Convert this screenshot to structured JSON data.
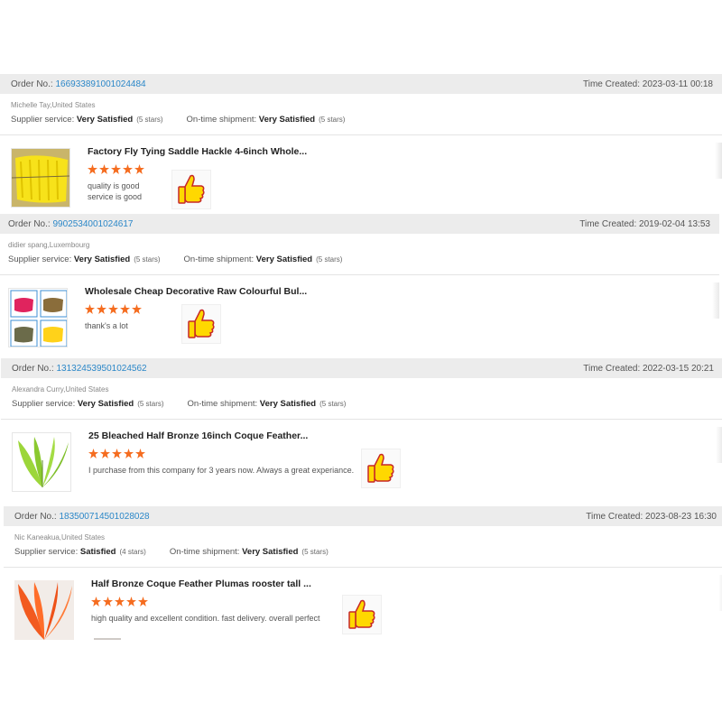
{
  "reviews": [
    {
      "order_label": "Order No.:",
      "order_no": "166933891001024484",
      "time_label": "Time Created:",
      "time_created": "2023-03-11 00:18",
      "buyer": "Michelle Tay,United States",
      "supplier_label": "Supplier service:",
      "supplier_value": "Very Satisfied",
      "supplier_stars": "(5 stars)",
      "shipment_label": "On-time shipment:",
      "shipment_value": "Very Satisfied",
      "shipment_stars": "(5 stars)",
      "product_title": "Factory Fly Tying Saddle Hackle 4-6inch Whole...",
      "rating": 5,
      "comment_lines": [
        "quality is good",
        "service is good"
      ]
    },
    {
      "order_label": "Order No.:",
      "order_no": "9902534001024617",
      "time_label": "Time Created:",
      "time_created": "2019-02-04 13:53",
      "buyer": "didier spang,Luxembourg",
      "supplier_label": "Supplier service:",
      "supplier_value": "Very Satisfied",
      "supplier_stars": "(5 stars)",
      "shipment_label": "On-time shipment:",
      "shipment_value": "Very Satisfied",
      "shipment_stars": "(5 stars)",
      "product_title": "Wholesale Cheap Decorative Raw Colourful Bul...",
      "rating": 5,
      "comment_lines": [
        "thank's a lot"
      ]
    },
    {
      "order_label": "Order No.:",
      "order_no": "131324539501024562",
      "time_label": "Time Created:",
      "time_created": "2022-03-15 20:21",
      "buyer": "Alexandra Curry,United States",
      "supplier_label": "Supplier service:",
      "supplier_value": "Very Satisfied",
      "supplier_stars": "(5 stars)",
      "shipment_label": "On-time shipment:",
      "shipment_value": "Very Satisfied",
      "shipment_stars": "(5 stars)",
      "product_title": "25 Bleached Half Bronze 16inch Coque Feather...",
      "rating": 5,
      "comment_lines": [
        "I purchase from this company for 3 years now. Always a great experiance."
      ]
    },
    {
      "order_label": "Order No.:",
      "order_no": "183500714501028028",
      "time_label": "Time Created:",
      "time_created": "2023-08-23 16:30",
      "buyer": "Nic Kaneakua,United States",
      "supplier_label": "Supplier service:",
      "supplier_value": "Satisfied",
      "supplier_stars": "(4 stars)",
      "shipment_label": "On-time shipment:",
      "shipment_value": "Very Satisfied",
      "shipment_stars": "(5 stars)",
      "product_title": "Half Bronze Coque Feather Plumas rooster tall ...",
      "rating": 5,
      "comment_lines": [
        "high quality and excellent condition. fast delivery.   overall perfect"
      ]
    }
  ],
  "colors": {
    "link": "#2b87c8",
    "star": "#f56c1f",
    "order_bar": "#ececec",
    "thumbs_up": "#ffd800"
  },
  "icons": [
    "star-icon",
    "thumbs-up-icon"
  ]
}
